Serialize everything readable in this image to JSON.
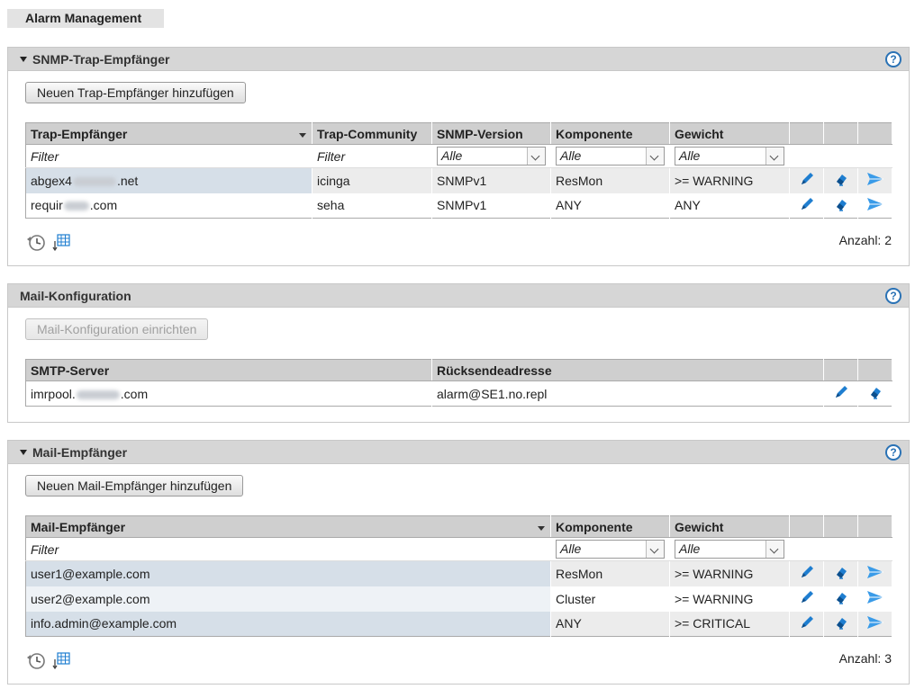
{
  "page": {
    "tab_title": "Alarm Management"
  },
  "trap_section": {
    "title": "SNMP-Trap-Empfänger",
    "help": "?",
    "add_button": "Neuen Trap-Empfänger hinzufügen",
    "columns": [
      "Trap-Empfänger",
      "Trap-Community",
      "SNMP-Version",
      "Komponente",
      "Gewicht"
    ],
    "filter": {
      "receiver": "Filter",
      "community": "Filter",
      "version": "Alle",
      "component": "Alle",
      "weight": "Alle"
    },
    "rows": [
      {
        "receiver_prefix": "abgex4",
        "receiver_suffix": ".net",
        "community": "icinga",
        "version": "SNMPv1",
        "component": "ResMon",
        "weight": ">= WARNING"
      },
      {
        "receiver_prefix": "requir",
        "receiver_suffix": ".com",
        "community": "seha",
        "version": "SNMPv1",
        "component": "ANY",
        "weight": "ANY"
      }
    ],
    "count": "Anzahl: 2"
  },
  "mail_config_section": {
    "title": "Mail-Konfiguration",
    "help": "?",
    "setup_button": "Mail-Konfiguration einrichten",
    "columns": [
      "SMTP-Server",
      "Rücksendeadresse"
    ],
    "rows": [
      {
        "server_prefix": "imrpool.",
        "server_suffix": ".com",
        "return_address": "alarm@SE1.no.repl"
      }
    ]
  },
  "mail_recipient_section": {
    "title": "Mail-Empfänger",
    "help": "?",
    "add_button": "Neuen Mail-Empfänger hinzufügen",
    "columns": [
      "Mail-Empfänger",
      "Komponente",
      "Gewicht"
    ],
    "filter": {
      "recipient": "Filter",
      "component": "Alle",
      "weight": "Alle"
    },
    "rows": [
      {
        "recipient": "user1@example.com",
        "component": "ResMon",
        "weight": ">= WARNING"
      },
      {
        "recipient": "user2@example.com",
        "component": "Cluster",
        "weight": ">= WARNING"
      },
      {
        "recipient": "info.admin@example.com",
        "component": "ANY",
        "weight": ">= CRITICAL"
      }
    ],
    "count": "Anzahl: 3"
  },
  "icons": {
    "edit": "pencil-icon",
    "erase": "eraser-icon",
    "test": "send-icon",
    "history": "history-icon",
    "export": "table-export-icon"
  },
  "colors": {
    "icon_blue": "#1f7ed0",
    "header_gray": "#d6d6d6",
    "help_blue": "#2a72b5"
  }
}
